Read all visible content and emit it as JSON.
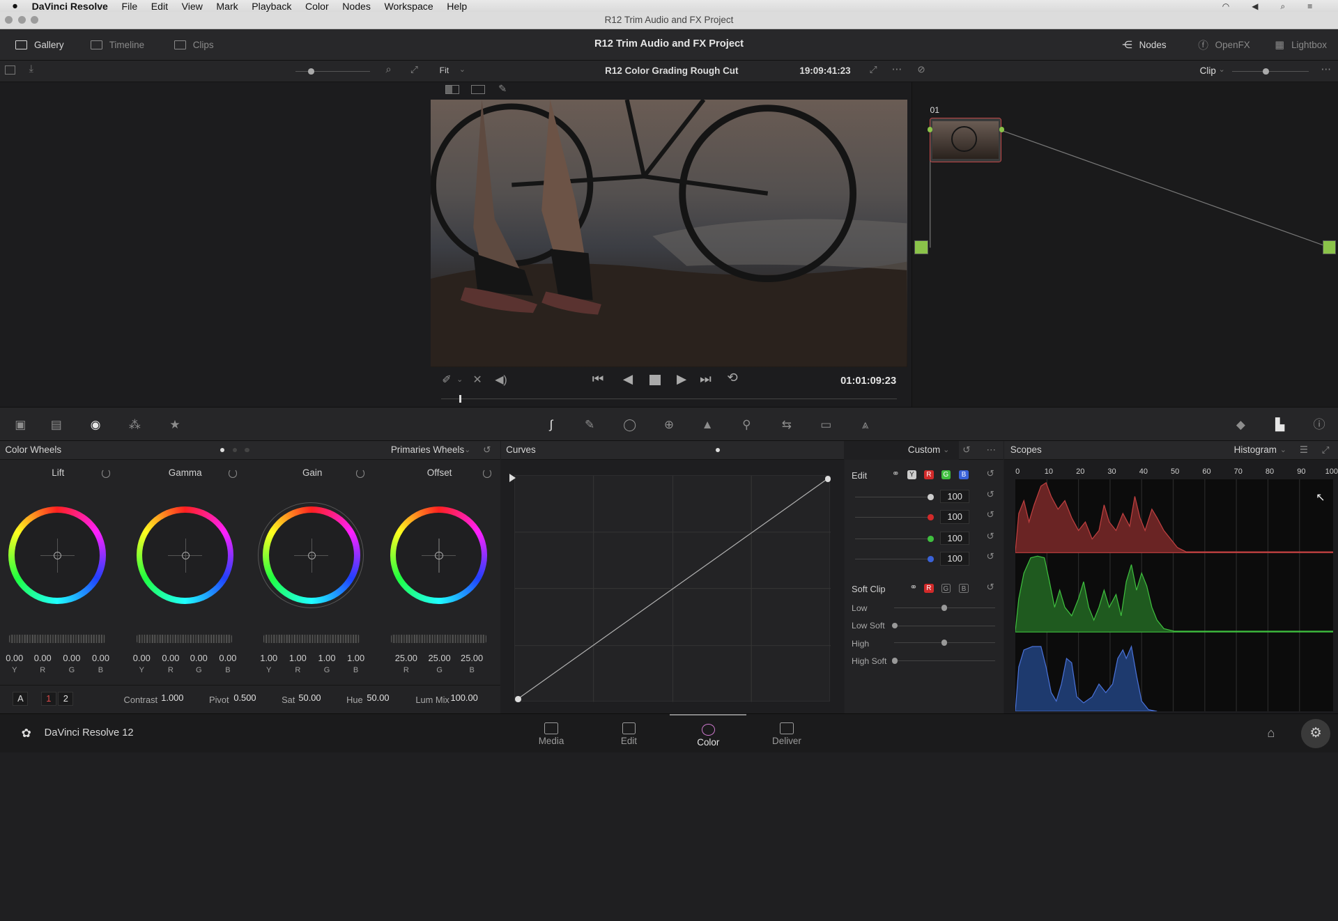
{
  "mac_menu": {
    "app": "DaVinci Resolve",
    "items": [
      "File",
      "Edit",
      "View",
      "Mark",
      "Playback",
      "Color",
      "Nodes",
      "Workspace",
      "Help"
    ]
  },
  "window_title": "R12 Trim Audio and FX Project",
  "topbar": {
    "gallery": "Gallery",
    "timeline": "Timeline",
    "clips": "Clips",
    "project_title": "R12 Trim Audio and FX Project",
    "nodes": "Nodes",
    "openfx": "OpenFX",
    "lightbox": "Lightbox"
  },
  "viewer": {
    "zoom": "Fit",
    "timeline_name": "R12 Color Grading Rough Cut",
    "timecode_top": "19:09:41:23",
    "timecode": "01:01:09:23",
    "clip_mode": "Clip",
    "playhead_progress": 0.04
  },
  "nodes": {
    "node_label": "01"
  },
  "color_wheels": {
    "title": "Color Wheels",
    "mode": "Primaries Wheels",
    "wheels": [
      {
        "name": "Lift",
        "values": [
          "0.00",
          "0.00",
          "0.00",
          "0.00"
        ],
        "channels": [
          "Y",
          "R",
          "G",
          "B"
        ]
      },
      {
        "name": "Gamma",
        "values": [
          "0.00",
          "0.00",
          "0.00",
          "0.00"
        ],
        "channels": [
          "Y",
          "R",
          "G",
          "B"
        ]
      },
      {
        "name": "Gain",
        "values": [
          "1.00",
          "1.00",
          "1.00",
          "1.00"
        ],
        "channels": [
          "Y",
          "R",
          "G",
          "B"
        ]
      },
      {
        "name": "Offset",
        "values": [
          "25.00",
          "25.00",
          "25.00"
        ],
        "channels": [
          "R",
          "G",
          "B"
        ]
      }
    ],
    "page_a": "A",
    "page_1": "1",
    "page_2": "2",
    "contrast_label": "Contrast",
    "contrast": "1.000",
    "pivot_label": "Pivot",
    "pivot": "0.500",
    "sat_label": "Sat",
    "sat": "50.00",
    "hue_label": "Hue",
    "hue": "50.00",
    "lummix_label": "Lum Mix",
    "lummix": "100.00"
  },
  "curves": {
    "title": "Curves",
    "mode": "Custom"
  },
  "curve_edit": {
    "edit_label": "Edit",
    "y": "Y",
    "r": "R",
    "g": "G",
    "b": "B",
    "intensities": [
      "100",
      "100",
      "100",
      "100"
    ],
    "softclip_label": "Soft Clip",
    "low": "Low",
    "low_soft": "Low Soft",
    "high": "High",
    "high_soft": "High Soft"
  },
  "scopes": {
    "title": "Scopes",
    "mode": "Histogram",
    "ticks": [
      "0",
      "10",
      "20",
      "30",
      "40",
      "50",
      "60",
      "70",
      "80",
      "90",
      "100"
    ]
  },
  "bottom": {
    "app_name": "DaVinci Resolve 12",
    "media": "Media",
    "edit": "Edit",
    "color": "Color",
    "deliver": "Deliver"
  },
  "colors": {
    "red": "#d22a2a",
    "green": "#3fbf3f",
    "blue": "#3a62d8",
    "node_accent": "#8bc34a"
  }
}
